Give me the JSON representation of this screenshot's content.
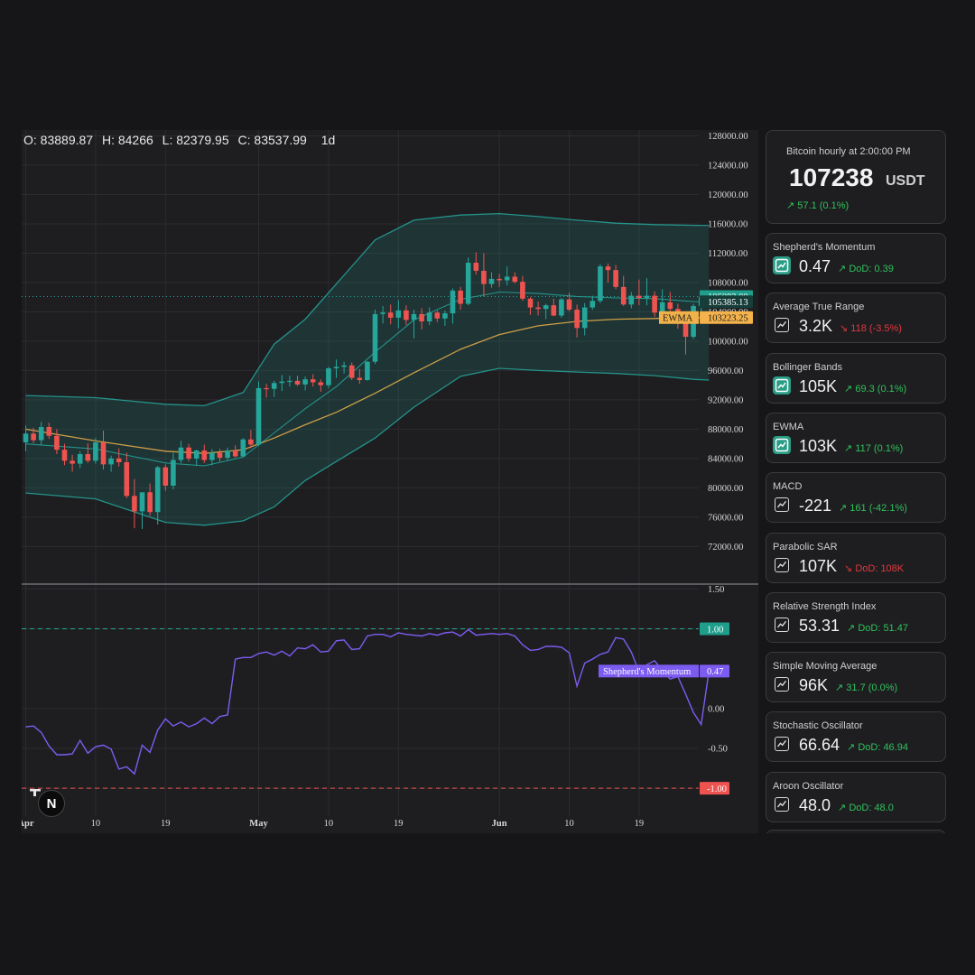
{
  "ohlc": {
    "open": "O: 83889.87",
    "high": "H: 84266",
    "low": "L: 82379.95",
    "close": "C: 83537.99",
    "interval": "1d"
  },
  "colors": {
    "up": "#26a69a",
    "down": "#ef5350",
    "band": "#26a69a",
    "ewma": "#f0b14a",
    "momentum": "#7c5cf0",
    "ref_high": "#26a69a",
    "ref_low": "#ef5350"
  },
  "price_axis": {
    "labels": [
      "128000.00",
      "124000.00",
      "120000.00",
      "116000.00",
      "112000.00",
      "108000.00",
      "104000.00",
      "100000.00",
      "96000.00",
      "92000.00",
      "88000.00",
      "84000.00",
      "80000.00",
      "76000.00",
      "72000.00"
    ],
    "ticks": [
      128000,
      124000,
      120000,
      116000,
      112000,
      108000,
      104000,
      100000,
      96000,
      92000,
      88000,
      84000,
      80000,
      76000,
      72000
    ],
    "range": [
      67000,
      128800
    ]
  },
  "price_tags": [
    {
      "text": "106083.00",
      "value": 106083,
      "kind": "last"
    },
    {
      "text": "105385.13",
      "value": 105385,
      "kind": "band"
    },
    {
      "text": "103223.25",
      "value": 103223,
      "kind": "ewma"
    }
  ],
  "ewma_label": "EWMA",
  "momentum_axis": {
    "labels": [
      "1.50",
      "1.00",
      "0.00",
      "-0.50",
      "-1.00"
    ],
    "ticks": [
      1.5,
      1.0,
      0.0,
      -0.5,
      -1.0
    ],
    "range": [
      -1.35,
      1.55
    ]
  },
  "momentum_tags": [
    {
      "text": "1.00",
      "value": 1.0,
      "kind": "high"
    },
    {
      "text": "0.47",
      "value": 0.47,
      "kind": "current"
    },
    {
      "text": "-1.00",
      "value": -1.0,
      "kind": "low"
    }
  ],
  "momentum_label": "Shepherd's Momentum",
  "time_axis": [
    {
      "label": "Apr",
      "bold": true,
      "day": 0
    },
    {
      "label": "10",
      "bold": false,
      "day": 9
    },
    {
      "label": "19",
      "bold": false,
      "day": 18
    },
    {
      "label": "May",
      "bold": true,
      "day": 30
    },
    {
      "label": "10",
      "bold": false,
      "day": 39
    },
    {
      "label": "19",
      "bold": false,
      "day": 48
    },
    {
      "label": "Jun",
      "bold": true,
      "day": 61
    },
    {
      "label": "10",
      "bold": false,
      "day": 70
    },
    {
      "label": "19",
      "bold": false,
      "day": 79
    }
  ],
  "chart_data": {
    "type": "candlestick",
    "candles": [
      [
        86200,
        88500,
        85000,
        87400
      ],
      [
        87400,
        88200,
        86100,
        86500
      ],
      [
        86500,
        89000,
        85800,
        88300
      ],
      [
        88300,
        88900,
        86700,
        87100
      ],
      [
        87100,
        88000,
        84600,
        85200
      ],
      [
        85200,
        86000,
        83100,
        83700
      ],
      [
        83700,
        84500,
        82200,
        83300
      ],
      [
        83300,
        85000,
        82700,
        84600
      ],
      [
        84600,
        86100,
        83400,
        83700
      ],
      [
        83700,
        86800,
        83300,
        86200
      ],
      [
        86200,
        87800,
        82500,
        83200
      ],
      [
        83200,
        84400,
        82200,
        84000
      ],
      [
        84000,
        85400,
        82900,
        83500
      ],
      [
        83500,
        84800,
        78600,
        78900
      ],
      [
        78900,
        81200,
        74500,
        76800
      ],
      [
        76800,
        77800,
        74400,
        79400
      ],
      [
        79400,
        80600,
        76200,
        76700
      ],
      [
        76700,
        83000,
        75000,
        82800
      ],
      [
        82800,
        83200,
        79600,
        80300
      ],
      [
        80300,
        84800,
        79800,
        83800
      ],
      [
        83800,
        86400,
        83400,
        85500
      ],
      [
        85500,
        86000,
        83600,
        84000
      ],
      [
        84000,
        85200,
        83000,
        85100
      ],
      [
        85100,
        85900,
        83400,
        83800
      ],
      [
        83800,
        85300,
        83100,
        84800
      ],
      [
        84800,
        85300,
        83600,
        84100
      ],
      [
        84100,
        85500,
        83800,
        85100
      ],
      [
        85100,
        85800,
        84100,
        84300
      ],
      [
        84300,
        86800,
        84200,
        86600
      ],
      [
        86600,
        87900,
        85400,
        85900
      ],
      [
        85900,
        94500,
        85700,
        93600
      ],
      [
        93600,
        94200,
        92300,
        93500
      ],
      [
        93500,
        94600,
        92400,
        94300
      ],
      [
        94300,
        95400,
        93200,
        94500
      ],
      [
        94500,
        95300,
        93800,
        94600
      ],
      [
        94600,
        95300,
        93900,
        94100
      ],
      [
        94100,
        95200,
        93300,
        94800
      ],
      [
        94800,
        95500,
        93800,
        94400
      ],
      [
        94400,
        94800,
        93100,
        94000
      ],
      [
        94000,
        96500,
        93600,
        96300
      ],
      [
        96300,
        97500,
        95000,
        96500
      ],
      [
        96500,
        97200,
        95600,
        96700
      ],
      [
        96700,
        97100,
        94700,
        95000
      ],
      [
        95000,
        96200,
        94200,
        94700
      ],
      [
        94700,
        97300,
        94600,
        97200
      ],
      [
        97200,
        104300,
        96900,
        103700
      ],
      [
        103700,
        104800,
        102400,
        103900
      ],
      [
        103900,
        105000,
        102300,
        103200
      ],
      [
        103200,
        105600,
        101800,
        104200
      ],
      [
        104200,
        104900,
        102200,
        102900
      ],
      [
        102900,
        104300,
        100400,
        103700
      ],
      [
        103700,
        104500,
        101600,
        102700
      ],
      [
        102700,
        104600,
        102200,
        103900
      ],
      [
        103900,
        104200,
        102600,
        103100
      ],
      [
        103100,
        104200,
        102100,
        103800
      ],
      [
        103800,
        107200,
        102400,
        106900
      ],
      [
        106900,
        107400,
        104300,
        105100
      ],
      [
        105100,
        111400,
        104900,
        110700
      ],
      [
        110700,
        112100,
        109100,
        109600
      ],
      [
        109600,
        112000,
        106100,
        107800
      ],
      [
        107800,
        109400,
        107300,
        108500
      ],
      [
        108500,
        109200,
        107400,
        108300
      ],
      [
        108300,
        110200,
        107600,
        108800
      ],
      [
        108800,
        109400,
        107900,
        108100
      ],
      [
        108100,
        108900,
        105500,
        105800
      ],
      [
        105800,
        106000,
        103600,
        104600
      ],
      [
        104600,
        105400,
        103500,
        104400
      ],
      [
        104400,
        105100,
        103000,
        104900
      ],
      [
        104900,
        105800,
        103400,
        103500
      ],
      [
        103500,
        105900,
        103200,
        105700
      ],
      [
        105700,
        106600,
        104100,
        104300
      ],
      [
        104300,
        105000,
        100500,
        101800
      ],
      [
        101800,
        105200,
        100800,
        104600
      ],
      [
        104600,
        106200,
        104300,
        105500
      ],
      [
        105500,
        110500,
        105200,
        110200
      ],
      [
        110200,
        110600,
        108000,
        109700
      ],
      [
        109700,
        110400,
        107100,
        107400
      ],
      [
        107400,
        108900,
        104800,
        105000
      ],
      [
        105000,
        106700,
        104500,
        106200
      ],
      [
        106200,
        108400,
        104900,
        105900
      ],
      [
        105900,
        108600,
        104900,
        106200
      ],
      [
        106200,
        106800,
        103300,
        103900
      ],
      [
        103900,
        107100,
        103400,
        105300
      ],
      [
        105300,
        106700,
        103700,
        104400
      ],
      [
        104400,
        105100,
        101700,
        102700
      ],
      [
        102700,
        103300,
        98200,
        100600
      ],
      [
        100600,
        105100,
        100300,
        104800
      ],
      [
        104800,
        106500,
        104000,
        106083
      ]
    ],
    "bollinger_upper": [
      [
        0,
        92600
      ],
      [
        9,
        92300
      ],
      [
        18,
        91400
      ],
      [
        23,
        91200
      ],
      [
        28,
        93000
      ],
      [
        32,
        99600
      ],
      [
        36,
        103000
      ],
      [
        40,
        107800
      ],
      [
        45,
        113800
      ],
      [
        50,
        116500
      ],
      [
        56,
        117200
      ],
      [
        61,
        117400
      ],
      [
        66,
        117000
      ],
      [
        71,
        116500
      ],
      [
        76,
        116100
      ],
      [
        81,
        115900
      ],
      [
        86,
        115800
      ],
      [
        88,
        115800
      ]
    ],
    "bollinger_middle": [
      [
        0,
        86000
      ],
      [
        9,
        85300
      ],
      [
        18,
        83400
      ],
      [
        23,
        83000
      ],
      [
        28,
        84200
      ],
      [
        32,
        87500
      ],
      [
        36,
        90800
      ],
      [
        40,
        93800
      ],
      [
        45,
        98500
      ],
      [
        50,
        102900
      ],
      [
        56,
        105700
      ],
      [
        61,
        106700
      ],
      [
        66,
        106500
      ],
      [
        71,
        106100
      ],
      [
        76,
        105900
      ],
      [
        81,
        105800
      ],
      [
        86,
        105400
      ],
      [
        88,
        105385
      ]
    ],
    "bollinger_lower": [
      [
        0,
        79300
      ],
      [
        9,
        78500
      ],
      [
        18,
        75300
      ],
      [
        23,
        74900
      ],
      [
        28,
        75500
      ],
      [
        32,
        77400
      ],
      [
        36,
        81000
      ],
      [
        40,
        83600
      ],
      [
        45,
        86800
      ],
      [
        50,
        91000
      ],
      [
        56,
        95200
      ],
      [
        61,
        96300
      ],
      [
        66,
        96000
      ],
      [
        71,
        95800
      ],
      [
        76,
        95600
      ],
      [
        81,
        95300
      ],
      [
        86,
        94800
      ],
      [
        88,
        94700
      ]
    ],
    "ewma": [
      [
        0,
        88000
      ],
      [
        9,
        86400
      ],
      [
        18,
        85000
      ],
      [
        23,
        84700
      ],
      [
        28,
        85200
      ],
      [
        32,
        86800
      ],
      [
        36,
        88600
      ],
      [
        40,
        90300
      ],
      [
        45,
        92900
      ],
      [
        50,
        95700
      ],
      [
        56,
        98900
      ],
      [
        61,
        100900
      ],
      [
        66,
        102100
      ],
      [
        71,
        102700
      ],
      [
        76,
        103000
      ],
      [
        81,
        103100
      ],
      [
        86,
        103200
      ],
      [
        88,
        103223
      ]
    ],
    "momentum": [
      -0.23,
      -0.22,
      -0.3,
      -0.47,
      -0.58,
      -0.58,
      -0.57,
      -0.4,
      -0.56,
      -0.48,
      -0.46,
      -0.51,
      -0.76,
      -0.73,
      -0.82,
      -0.46,
      -0.55,
      -0.27,
      -0.13,
      -0.22,
      -0.17,
      -0.23,
      -0.19,
      -0.12,
      -0.19,
      -0.1,
      -0.08,
      0.62,
      0.64,
      0.64,
      0.69,
      0.71,
      0.67,
      0.72,
      0.66,
      0.76,
      0.75,
      0.8,
      0.71,
      0.72,
      0.85,
      0.86,
      0.74,
      0.75,
      0.91,
      0.93,
      0.93,
      0.9,
      0.95,
      0.93,
      0.92,
      0.91,
      0.94,
      0.92,
      0.95,
      0.96,
      0.91,
      0.99,
      0.92,
      0.93,
      0.94,
      0.93,
      0.94,
      0.91,
      0.8,
      0.73,
      0.74,
      0.78,
      0.78,
      0.77,
      0.7,
      0.28,
      0.57,
      0.62,
      0.68,
      0.71,
      0.89,
      0.87,
      0.71,
      0.46,
      0.55,
      0.6,
      0.48,
      0.37,
      0.4,
      0.18,
      -0.05,
      -0.2,
      0.47
    ],
    "ylim": [
      67000,
      128800
    ],
    "momentum_ylim": [
      -1.35,
      1.55
    ]
  },
  "sidebar": {
    "price_card": {
      "title": "Bitcoin hourly at 2:00:00 PM",
      "price": "107238",
      "unit": "USDT",
      "change": "↗ 57.1 (0.1%)"
    },
    "indicators": [
      {
        "name": "Shepherd's Momentum",
        "value": "0.47",
        "change": "↗ DoD: 0.39",
        "dir": "up",
        "icon": "line-chart-icon",
        "highlight": true
      },
      {
        "name": "Average True Range",
        "value": "3.2K",
        "change": "↘ 118 (-3.5%)",
        "dir": "down",
        "icon": "line-chart-icon",
        "highlight": false
      },
      {
        "name": "Bollinger Bands",
        "value": "105K",
        "change": "↗ 69.3 (0.1%)",
        "dir": "up",
        "icon": "line-chart-icon",
        "highlight": true
      },
      {
        "name": "EWMA",
        "value": "103K",
        "change": "↗ 117 (0.1%)",
        "dir": "up",
        "icon": "line-chart-icon",
        "highlight": true
      },
      {
        "name": "MACD",
        "value": "-221",
        "change": "↗ 161 (-42.1%)",
        "dir": "up",
        "icon": "line-chart-icon",
        "highlight": false
      },
      {
        "name": "Parabolic SAR",
        "value": "107K",
        "change": "↘ DoD: 108K",
        "dir": "down",
        "icon": "line-chart-icon",
        "highlight": false
      },
      {
        "name": "Relative Strength Index",
        "value": "53.31",
        "change": "↗ DoD: 51.47",
        "dir": "up",
        "icon": "line-chart-icon",
        "highlight": false
      },
      {
        "name": "Simple Moving Average",
        "value": "96K",
        "change": "↗ 31.7 (0.0%)",
        "dir": "up",
        "icon": "line-chart-icon",
        "highlight": false
      },
      {
        "name": "Stochastic Oscillator",
        "value": "66.64",
        "change": "↗ DoD: 46.94",
        "dir": "up",
        "icon": "line-chart-icon",
        "highlight": false
      },
      {
        "name": "Aroon Oscillator",
        "value": "48.0",
        "change": "↗ DoD: 48.0",
        "dir": "up",
        "icon": "line-chart-icon",
        "highlight": false
      }
    ]
  },
  "logo_text": "N"
}
